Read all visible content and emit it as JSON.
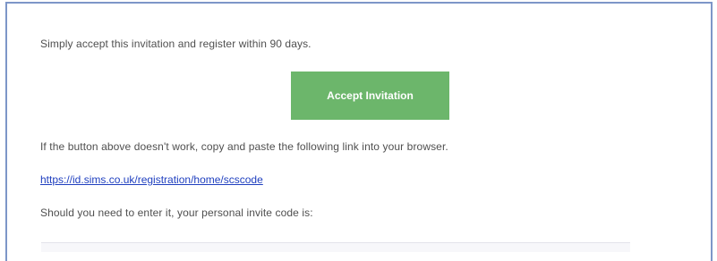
{
  "email": {
    "intro_text": "Simply accept this invitation and register within 90 days.",
    "accept_button_label": "Accept Invitation",
    "fallback_text": "If the button above doesn't work, copy and paste the following link into your browser.",
    "registration_link": "https://id.sims.co.uk/registration/home/scscode",
    "invite_code_text": "Should you need to enter it, your personal invite code is:"
  },
  "colors": {
    "button_background": "#6cb66b",
    "link_color": "#1f3fbf",
    "panel_border": "#7d96c8"
  }
}
